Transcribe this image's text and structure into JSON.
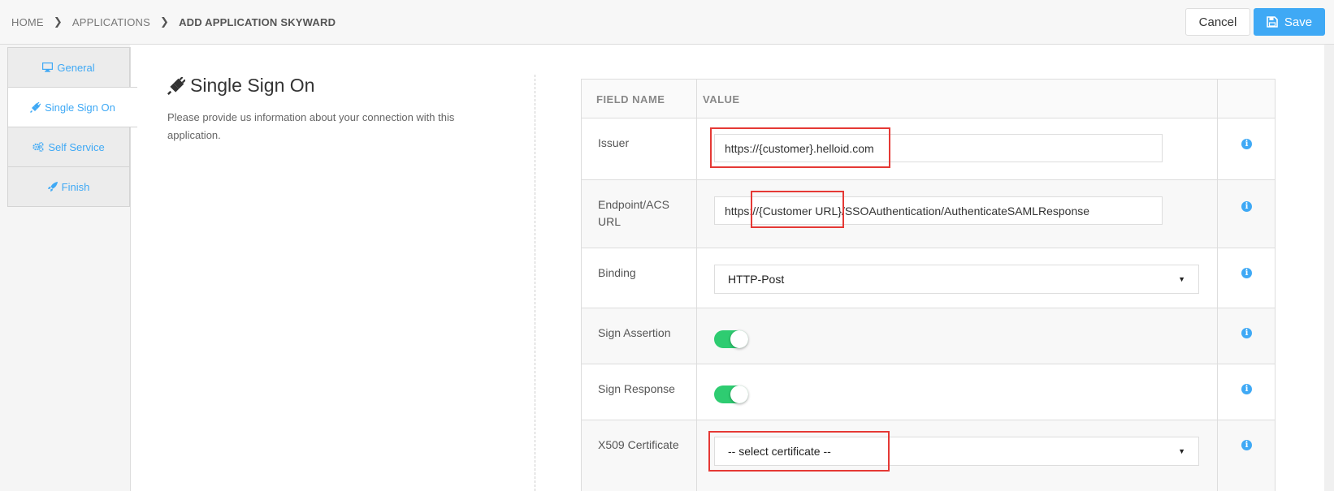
{
  "breadcrumb": {
    "items": [
      "HOME",
      "APPLICATIONS",
      "ADD APPLICATION SKYWARD"
    ]
  },
  "header": {
    "cancel_label": "Cancel",
    "save_label": "Save"
  },
  "sidebar": {
    "items": [
      {
        "label": "General",
        "icon": "monitor-icon"
      },
      {
        "label": "Single Sign On",
        "icon": "plug-icon",
        "active": true
      },
      {
        "label": "Self Service",
        "icon": "gears-icon"
      },
      {
        "label": "Finish",
        "icon": "rocket-icon"
      }
    ]
  },
  "section": {
    "title": "Single Sign On",
    "description": "Please provide us information about your connection with this application."
  },
  "table": {
    "headers": {
      "field": "FIELD NAME",
      "value": "VALUE"
    },
    "rows": {
      "issuer": {
        "label": "Issuer",
        "value": "https://{customer}.helloid.com"
      },
      "endpoint": {
        "label": "Endpoint/ACS URL",
        "value": "https://{Customer URL}/SSOAuthentication/AuthenticateSAMLResponse"
      },
      "binding": {
        "label": "Binding",
        "value": "HTTP-Post"
      },
      "sign_assertion": {
        "label": "Sign Assertion",
        "enabled": true
      },
      "sign_response": {
        "label": "Sign Response",
        "enabled": true
      },
      "x509": {
        "label": "X509 Certificate",
        "value": "-- select certificate --"
      }
    },
    "info_glyph": "i"
  },
  "colors": {
    "accent": "#3fa9f5",
    "toggle_on": "#2ecc71",
    "highlight": "#e53935"
  }
}
